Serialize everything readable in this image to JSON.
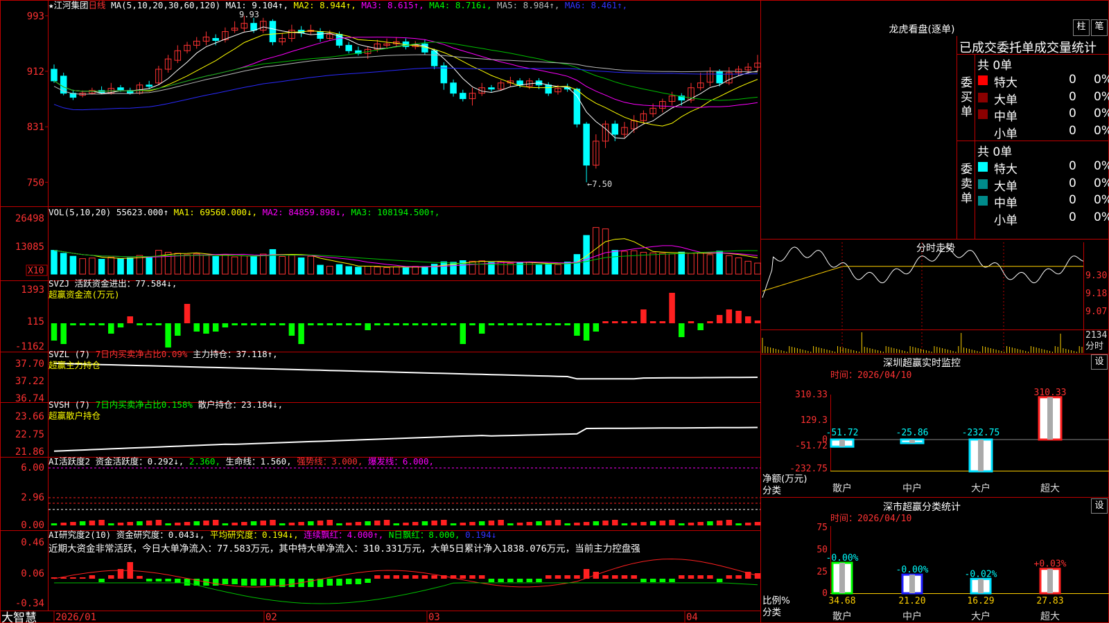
{
  "app": {
    "name": "大智慧",
    "stock": "江河集团",
    "period": "日线"
  },
  "kline": {
    "ma_label": "MA(5,10,20,30,60,120)",
    "ma_values": [
      {
        "name": "MA1",
        "value": "9.104↑",
        "color": "#ffffff"
      },
      {
        "name": "MA2",
        "value": "8.944↑",
        "color": "#ffff00"
      },
      {
        "name": "MA3",
        "value": "8.615↑",
        "color": "#ff00ff"
      },
      {
        "name": "MA4",
        "value": "8.716↓",
        "color": "#00ff00"
      },
      {
        "name": "MA5",
        "value": "8.984↑",
        "color": "#bbbbbb"
      },
      {
        "name": "MA6",
        "value": "8.461↑",
        "color": "#3333ff"
      }
    ],
    "y_ticks": [
      "993",
      "912",
      "831",
      "750"
    ],
    "high_label": "9.93",
    "low_label": "7.50"
  },
  "vol": {
    "label": "VOL(5,10,20)",
    "value": "55623.000↑",
    "ma": [
      {
        "name": "MA1",
        "value": "69560.000↓",
        "color": "#ffff00"
      },
      {
        "name": "MA2",
        "value": "84859.898↓",
        "color": "#ff00ff"
      },
      {
        "name": "MA3",
        "value": "108194.500↑",
        "color": "#00ff00"
      }
    ],
    "y_ticks": [
      "26498",
      "13085"
    ],
    "unit": "X10"
  },
  "svzj": {
    "label": "SVZJ",
    "desc": "活跃资金进出：77.584↓,",
    "sub": "超赢资金流(万元)",
    "y_ticks": [
      "1393",
      "115",
      "-1162"
    ]
  },
  "svzl": {
    "label": "SVZL (7)",
    "a": "7日内买卖净占比0.09%",
    "b": "主力持仓：37.118↑,",
    "sub": "超赢主力持仓",
    "y_ticks": [
      "37.70",
      "37.22",
      "36.74"
    ]
  },
  "svsh": {
    "label": "SVSH (7)",
    "a": "7日内买卖净占比0.158%",
    "b": "散户持仓：23.184↓,",
    "sub": "超赢散户持仓",
    "y_ticks": [
      "23.66",
      "22.75",
      "21.86"
    ]
  },
  "ai1": {
    "label": "AI活跃度2",
    "a": "资金活跃度：0.292↓,",
    "b": "2.360,",
    "c": "生命线：1.560,",
    "d": "强势线：3.000,",
    "e": "爆发线：6.000,",
    "y_ticks": [
      "6.00",
      "2.96",
      "0.00"
    ]
  },
  "ai2": {
    "label": "AI研究度2(10)",
    "a": "资金研究度：0.043↓,",
    "b": "平均研究度：0.194↓,",
    "c": "连续飘红：4.000↑,",
    "d": "N日飘红：8.000,",
    "e": "0.194↓",
    "summary": "近期大资金非常活跃，今日大单净流入：77.583万元，其中特大单净流入：310.331万元，大单5日累计净入1838.076万元，当前主力控盘强",
    "y_ticks": [
      "0.46",
      "0.06",
      "-0.34"
    ]
  },
  "x_axis": [
    "2026/01",
    "02",
    "03",
    "04"
  ],
  "lhb": {
    "title": "龙虎看盘(逐单)",
    "btn1": "柱",
    "btn2": "笔",
    "header": "已成交委托单成交量统计",
    "buy_label": "委买单",
    "sell_label": "委卖单",
    "buy_total": "共 0单",
    "sell_total": "共 0单",
    "buy_rows": [
      {
        "name": "特大",
        "count": "0",
        "pct": "0%"
      },
      {
        "name": "大单",
        "count": "0",
        "pct": "0%"
      },
      {
        "name": "中单",
        "count": "0",
        "pct": "0%"
      },
      {
        "name": "小单",
        "count": "0",
        "pct": "0%"
      }
    ],
    "sell_rows": [
      {
        "name": "特大",
        "count": "0",
        "pct": "0%"
      },
      {
        "name": "大单",
        "count": "0",
        "pct": "0%"
      },
      {
        "name": "中单",
        "count": "0",
        "pct": "0%"
      },
      {
        "name": "小单",
        "count": "0",
        "pct": "0%"
      }
    ]
  },
  "intraday": {
    "title": "分时走势",
    "y_ticks": [
      "9.30",
      "9.18",
      "9.07"
    ],
    "vol_tick": "2134",
    "vol_label": "分时"
  },
  "sz_monitor": {
    "title": "深圳超赢实时监控",
    "btn": "设",
    "time": "时间：2026/04/10",
    "y_ticks": [
      "310.33",
      "129.3",
      "0",
      "-51.72",
      "-232.75"
    ],
    "axis_label1": "净额(万元)",
    "axis_label2": "分类",
    "categories": [
      "散户",
      "中户",
      "大户",
      "超大"
    ],
    "values": [
      -51.72,
      -25.86,
      -232.75,
      310.33
    ],
    "value_labels": [
      "-51.72",
      "-25.86",
      "-232.75",
      "310.33"
    ]
  },
  "sz_class": {
    "title": "深市超赢分类统计",
    "btn": "设",
    "time": "时间：2026/04/10",
    "y_ticks": [
      "75",
      "50",
      "25",
      "0"
    ],
    "axis_label1": "比例%",
    "axis_label2": "分类",
    "categories": [
      "散户",
      "中户",
      "大户",
      "超大"
    ],
    "values": [
      34.68,
      21.2,
      16.29,
      27.83
    ],
    "value_labels": [
      "34.68",
      "21.20",
      "16.29",
      "27.83"
    ],
    "change_labels": [
      "-0.00%",
      "-0.00%",
      "-0.02%",
      "+0.03%"
    ]
  },
  "chart_data": [
    {
      "type": "candlestick",
      "title": "江河集团 日线",
      "ylim": [
        7.2,
        10.1
      ],
      "candles": [
        [
          9.15,
          8.98,
          9.22,
          8.95
        ],
        [
          9.05,
          8.8,
          9.1,
          8.77
        ],
        [
          8.8,
          8.74,
          8.85,
          8.7
        ],
        [
          8.77,
          8.8,
          8.84,
          8.74
        ],
        [
          8.8,
          8.84,
          8.88,
          8.78
        ],
        [
          8.84,
          8.81,
          8.9,
          8.79
        ],
        [
          8.8,
          8.87,
          8.95,
          8.78
        ],
        [
          8.88,
          8.85,
          8.92,
          8.82
        ],
        [
          8.84,
          8.8,
          8.88,
          8.78
        ],
        [
          8.8,
          8.92,
          8.96,
          8.78
        ],
        [
          8.92,
          8.9,
          8.98,
          8.86
        ],
        [
          8.95,
          9.15,
          9.2,
          8.92
        ],
        [
          9.15,
          9.3,
          9.36,
          9.1
        ],
        [
          9.28,
          9.42,
          9.5,
          9.24
        ],
        [
          9.42,
          9.5,
          9.55,
          9.38
        ],
        [
          9.5,
          9.56,
          9.62,
          9.45
        ],
        [
          9.56,
          9.62,
          9.7,
          9.5
        ],
        [
          9.6,
          9.57,
          9.66,
          9.5
        ],
        [
          9.58,
          9.7,
          9.76,
          9.54
        ],
        [
          9.72,
          9.75,
          9.85,
          9.68
        ],
        [
          9.75,
          9.82,
          9.93,
          9.7
        ],
        [
          9.82,
          9.72,
          9.9,
          9.68
        ],
        [
          9.72,
          9.85,
          9.9,
          9.68
        ],
        [
          9.85,
          9.55,
          9.88,
          9.5
        ],
        [
          9.55,
          9.6,
          9.68,
          9.5
        ],
        [
          9.6,
          9.72,
          9.8,
          9.55
        ],
        [
          9.72,
          9.68,
          9.78,
          9.62
        ],
        [
          9.7,
          9.72,
          9.8,
          9.65
        ],
        [
          9.7,
          9.6,
          9.75,
          9.55
        ],
        [
          9.6,
          9.66,
          9.72,
          9.58
        ],
        [
          9.66,
          9.5,
          9.7,
          9.46
        ],
        [
          9.5,
          9.42,
          9.55,
          9.38
        ],
        [
          9.42,
          9.38,
          9.48,
          9.35
        ],
        [
          9.38,
          9.44,
          9.48,
          9.3
        ],
        [
          9.44,
          9.52,
          9.58,
          9.4
        ],
        [
          9.5,
          9.52,
          9.6,
          9.45
        ],
        [
          9.52,
          9.55,
          9.62,
          9.48
        ],
        [
          9.55,
          9.48,
          9.6,
          9.44
        ],
        [
          9.48,
          9.5,
          9.56,
          9.44
        ],
        [
          9.52,
          9.4,
          9.58,
          9.36
        ],
        [
          9.42,
          9.2,
          9.45,
          9.15
        ],
        [
          9.2,
          8.95,
          9.25,
          8.85
        ],
        [
          8.95,
          8.8,
          9.0,
          8.75
        ],
        [
          8.8,
          8.72,
          8.85,
          8.68
        ],
        [
          8.72,
          8.8,
          8.88,
          8.62
        ],
        [
          8.8,
          8.88,
          8.95,
          8.76
        ],
        [
          8.88,
          8.86,
          8.92,
          8.82
        ],
        [
          8.86,
          8.95,
          8.99,
          8.84
        ],
        [
          8.95,
          8.98,
          9.04,
          8.9
        ],
        [
          8.98,
          8.92,
          9.02,
          8.88
        ],
        [
          8.9,
          8.98,
          9.02,
          8.86
        ],
        [
          8.98,
          8.92,
          9.02,
          8.86
        ],
        [
          8.92,
          8.8,
          8.96,
          8.76
        ],
        [
          8.82,
          8.87,
          8.92,
          8.78
        ],
        [
          8.88,
          8.86,
          8.94,
          8.82
        ],
        [
          8.86,
          8.35,
          8.88,
          8.3
        ],
        [
          8.35,
          7.75,
          8.38,
          7.5
        ],
        [
          7.75,
          8.1,
          8.2,
          7.7
        ],
        [
          8.1,
          8.35,
          8.4,
          8.0
        ],
        [
          8.35,
          8.2,
          8.4,
          8.1
        ],
        [
          8.2,
          8.3,
          8.38,
          8.15
        ],
        [
          8.28,
          8.4,
          8.48,
          8.22
        ],
        [
          8.4,
          8.5,
          8.55,
          8.35
        ],
        [
          8.5,
          8.58,
          8.65,
          8.45
        ],
        [
          8.58,
          8.68,
          8.72,
          8.52
        ],
        [
          8.68,
          8.76,
          8.82,
          8.62
        ],
        [
          8.76,
          8.7,
          8.8,
          8.62
        ],
        [
          8.7,
          8.88,
          8.95,
          8.66
        ],
        [
          8.88,
          8.95,
          9.1,
          8.84
        ],
        [
          8.96,
          9.12,
          9.18,
          8.9
        ],
        [
          9.12,
          8.95,
          9.15,
          8.9
        ],
        [
          8.95,
          9.1,
          9.18,
          8.92
        ],
        [
          9.1,
          9.15,
          9.2,
          9.05
        ],
        [
          9.14,
          9.18,
          9.24,
          9.08
        ],
        [
          9.18,
          9.24,
          9.36,
          9.12
        ]
      ]
    },
    {
      "type": "bar",
      "title": "VOL(5,10,20)",
      "ylim": [
        0,
        30000
      ],
      "values": [
        12000,
        10500,
        9000,
        7800,
        8100,
        7500,
        8600,
        7700,
        8200,
        9400,
        8800,
        12000,
        11000,
        10500,
        9800,
        10200,
        9500,
        8900,
        9900,
        8700,
        9200,
        8800,
        10100,
        12400,
        8900,
        9500,
        8200,
        9000,
        4500,
        4000,
        4800,
        3800,
        3500,
        4000,
        3600,
        3300,
        3700,
        3200,
        3900,
        3800,
        5000,
        6200,
        6000,
        6800,
        6500,
        6700,
        5900,
        6300,
        5400,
        5800,
        6100,
        4600,
        5200,
        4800,
        6100,
        9900,
        19500,
        23500,
        22800,
        12000,
        11500,
        11800,
        11000,
        10700,
        10500,
        10200,
        11100,
        10500,
        10700,
        9800,
        11600,
        9300,
        8200,
        6500,
        5562
      ]
    }
  ]
}
